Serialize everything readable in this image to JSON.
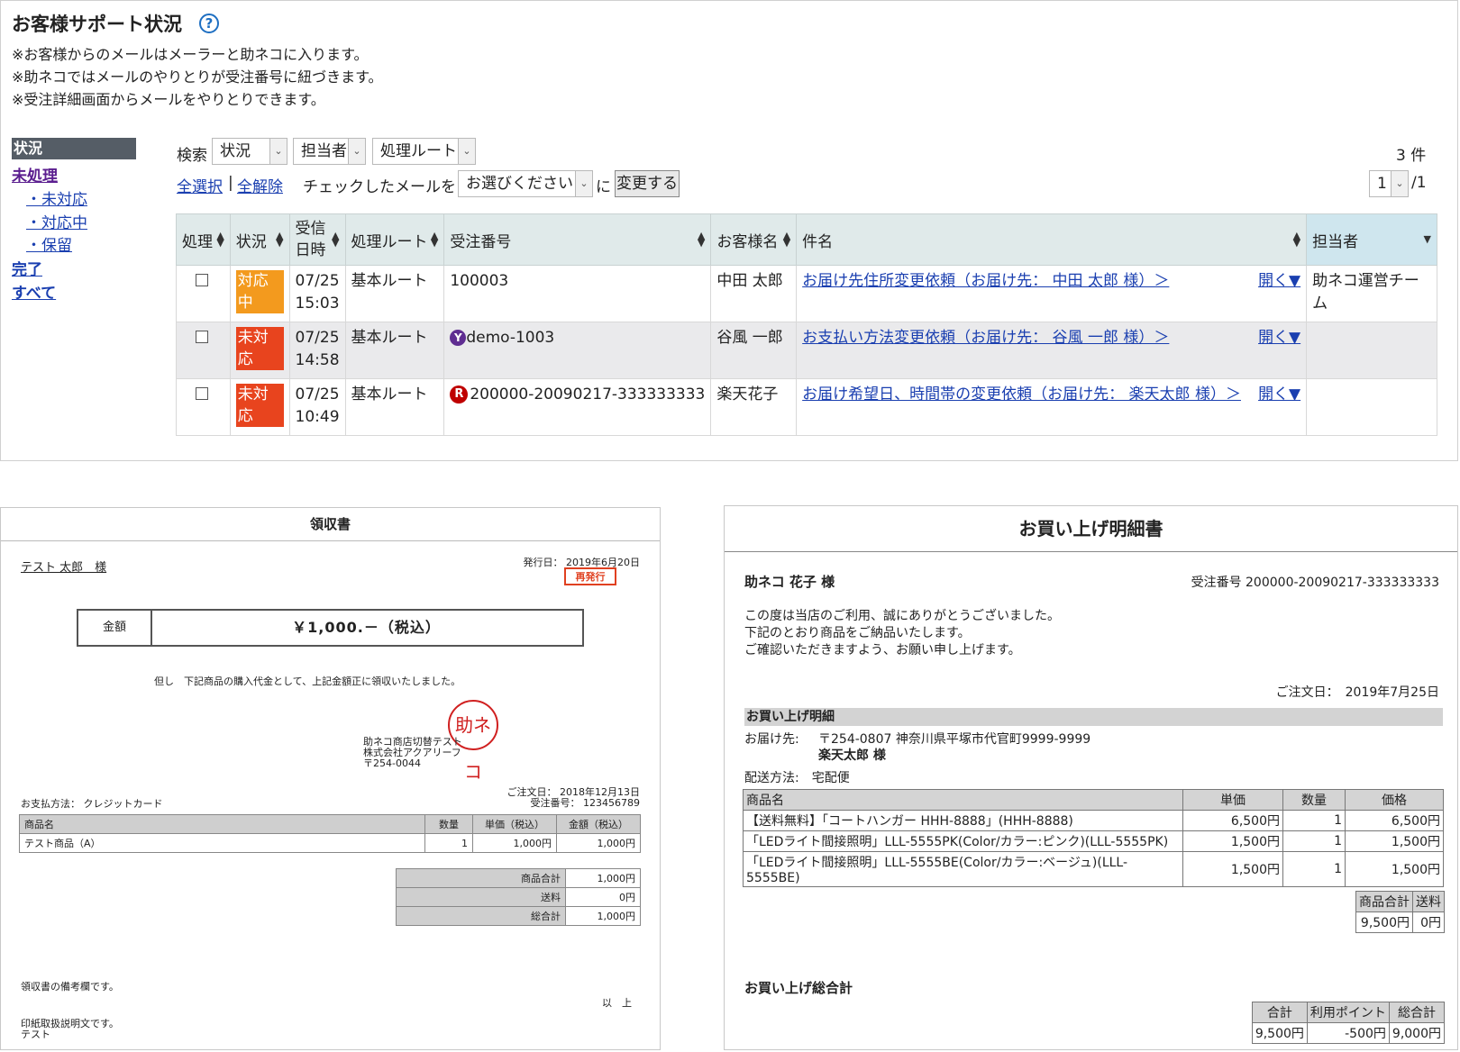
{
  "top": {
    "title": "お客様サポート状況",
    "help_icon": "question-circle-icon",
    "notes": [
      "※お客様からのメールはメーラーと助ネコに入ります。",
      "※助ネコではメールのやりとりが受注番号に紐づきます。",
      "※受注詳細画面からメールをやりとりできます。"
    ],
    "sidebar": {
      "header": "状況",
      "unprocessed": "未処理",
      "items": [
        "・未対応",
        "・対応中",
        "・保留"
      ],
      "done": "完了",
      "all": "すべて"
    },
    "search": {
      "label": "検索",
      "status_select": "状況",
      "assignee_select": "担当者",
      "route_select": "処理ルート"
    },
    "count": "3 件",
    "select_all": "全選択",
    "separator": "|",
    "deselect_all": "全解除",
    "checked_label": "チェックしたメールを",
    "action_select": "お選びください",
    "ni": "に",
    "change_button": "変更する",
    "page_current": "1",
    "page_total": "/1",
    "columns": [
      "処理",
      "状況",
      "受信日時",
      "処理ルート",
      "受注番号",
      "お客様名",
      "件名",
      "担当者"
    ],
    "rows": [
      {
        "status": "対応中",
        "status_color": "#f39a1e",
        "date": "07/25",
        "time": "15:03",
        "route": "基本ルート",
        "order_icon": "",
        "order": "100003",
        "customer": "中田 太郎",
        "subject": "お届け先住所変更依頼（お届け先： 中田 太郎 様）＞",
        "open": "開く▼",
        "assignee": "助ネコ運営チーム"
      },
      {
        "status": "未対応",
        "status_color": "#e8441e",
        "date": "07/25",
        "time": "14:58",
        "route": "基本ルート",
        "order_icon": "yahoo-icon",
        "order": "demo-1003",
        "customer": "谷風 一郎",
        "subject": "お支払い方法変更依頼（お届け先： 谷風 一郎 様）＞",
        "open": "開く▼",
        "assignee": ""
      },
      {
        "status": "未対応",
        "status_color": "#e8441e",
        "date": "07/25",
        "time": "10:49",
        "route": "基本ルート",
        "order_icon": "rakuten-icon",
        "order": "200000-20090217-333333333",
        "customer": "楽天花子",
        "subject": "お届け希望日、時間帯の変更依頼（お届け先： 楽天太郎 様）＞",
        "open": "開く▼",
        "assignee": ""
      }
    ]
  },
  "receipt": {
    "title": "領収書",
    "customer": "テスト 太郎　様",
    "issue_date": "発行日： 2019年6月20日",
    "reissue": "再発行",
    "amount_label": "金額",
    "amount_value": "￥1,000.－（税込）",
    "proviso": "但し　下記商品の購入代金として、上記金額正に領収いたしました。",
    "seal_text": "助ネコ",
    "shop_lines": [
      "助ネコ商店切替テスト",
      "株式会社アクアリーフ",
      "〒254-0044"
    ],
    "payment": "お支払方法： クレジットカード",
    "order_date": "ご注文日： 2018年12月13日",
    "order_no": "受注番号： 123456789",
    "item_headers": [
      "商品名",
      "数量",
      "単価（税込）",
      "金額（税込）"
    ],
    "items": [
      {
        "name": "テスト商品（A）",
        "qty": "1",
        "unit": "1,000円",
        "amount": "1,000円"
      }
    ],
    "totals": [
      {
        "label": "商品合計",
        "value": "1,000円"
      },
      {
        "label": "送料",
        "value": "0円"
      },
      {
        "label": "総合計",
        "value": "1,000円"
      }
    ],
    "remarks": "領収書の備考欄です。",
    "end_mark": "以　上",
    "stamp_note": [
      "印紙取扱説明文です。",
      "テスト"
    ]
  },
  "statement": {
    "title": "お買い上げ明細書",
    "customer": "助ネコ 花子 様",
    "order_no": "受注番号 200000-20090217-333333333",
    "greeting": [
      "この度は当店のご利用、誠にありがとうございました。",
      "下記のとおり商品をご納品いたします。",
      "ご確認いただきますよう、お願い申し上げます。"
    ],
    "order_date": "ご注文日：　2019年7月25日",
    "section": "お買い上げ明細",
    "ship_label": "お届け先:",
    "ship_address": "〒254-0807 神奈川県平塚市代官町9999-9999",
    "ship_name": "楽天太郎 様",
    "delivery": "配送方法:　宅配便",
    "item_headers": [
      "商品名",
      "単価",
      "数量",
      "価格"
    ],
    "items": [
      {
        "name": "【送料無料】「コートハンガー HHH-8888」(HHH-8888)",
        "unit": "6,500円",
        "qty": "1",
        "price": "6,500円"
      },
      {
        "name": "「LEDライト間接照明」LLL-5555PK(Color/カラー:ピンク)(LLL-5555PK)",
        "unit": "1,500円",
        "qty": "1",
        "price": "1,500円"
      },
      {
        "name": "「LEDライト間接照明」LLL-5555BE(Color/カラー:ベージュ)(LLL-5555BE)",
        "unit": "1,500円",
        "qty": "1",
        "price": "1,500円"
      }
    ],
    "subtotal_headers": [
      "商品合計",
      "送料"
    ],
    "subtotal_values": [
      "9,500円",
      "0円"
    ],
    "grand_label": "お買い上げ総合計",
    "grand_headers": [
      "合計",
      "利用ポイント",
      "総合計"
    ],
    "grand_values": [
      "9,500円",
      "-500円",
      "9,000円"
    ]
  }
}
